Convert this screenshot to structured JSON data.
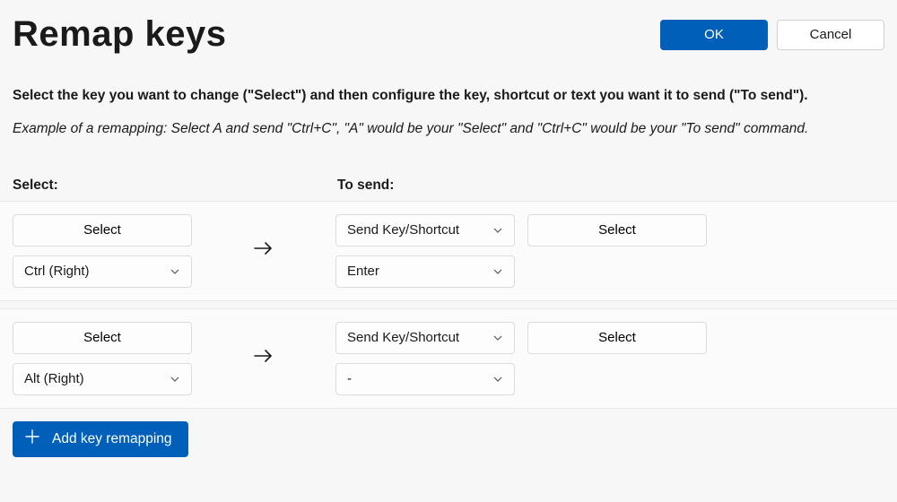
{
  "header": {
    "title": "Remap keys",
    "ok_label": "OK",
    "cancel_label": "Cancel"
  },
  "instructions": {
    "text": "Select the key you want to change (\"Select\") and then configure the key, shortcut or text you want it to send (\"To send\").",
    "example": "Example of a remapping: Select A and send \"Ctrl+C\", \"A\" would be your \"Select\" and \"Ctrl+C\" would be your \"To send\" command."
  },
  "columns": {
    "select_label": "Select:",
    "to_send_label": "To send:"
  },
  "rows": [
    {
      "select_button": "Select",
      "key_dropdown": "Ctrl (Right)",
      "send_type_dropdown": "Send Key/Shortcut",
      "send_select_button": "Select",
      "send_key_dropdown": "Enter"
    },
    {
      "select_button": "Select",
      "key_dropdown": "Alt (Right)",
      "send_type_dropdown": "Send Key/Shortcut",
      "send_select_button": "Select",
      "send_key_dropdown": "-"
    }
  ],
  "footer": {
    "add_label": "Add key remapping"
  }
}
